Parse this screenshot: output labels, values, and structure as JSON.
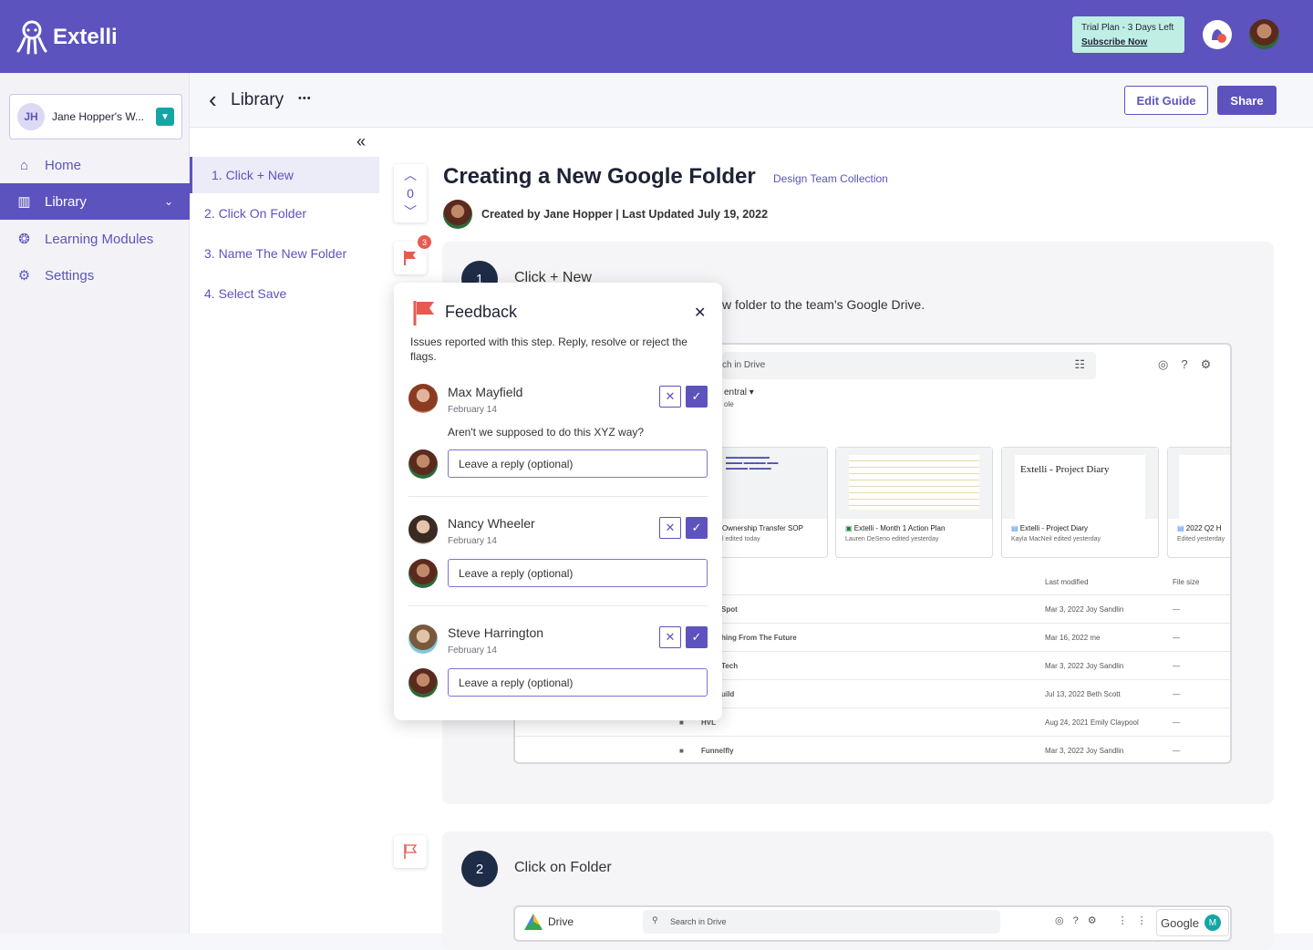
{
  "app": {
    "name": "Extelli",
    "trial_line1": "Trial Plan - 3 Days Left",
    "trial_line2": "Subscribe Now"
  },
  "workspace": {
    "initials": "JH",
    "name": "Jane Hopper's W..."
  },
  "sidebar": {
    "items": [
      {
        "label": "Home",
        "icon": "home-icon"
      },
      {
        "label": "Library",
        "icon": "library-icon"
      },
      {
        "label": "Learning Modules",
        "icon": "modules-icon"
      },
      {
        "label": "Settings",
        "icon": "gear-icon"
      }
    ]
  },
  "header": {
    "back": "‹",
    "title": "Library",
    "more": "•••",
    "edit_label": "Edit Guide",
    "share_label": "Share"
  },
  "steps": [
    "1. Click + New",
    "2. Click On Folder",
    "3. Name The New Folder",
    "4. Select Save"
  ],
  "guide": {
    "title": "Creating a New Google Folder",
    "collection": "Design Team Collection",
    "meta": "Created by Jane Hopper | Last Updated July 19, 2022",
    "vote_count": "0",
    "flag_count": "3"
  },
  "step1": {
    "num": "1",
    "title": "Click + New",
    "desc": "w folder to the team's Google Drive."
  },
  "step2": {
    "num": "2",
    "title": "Click on Folder"
  },
  "drive1": {
    "search": "ch in Drive",
    "folder": "entral",
    "sub": "ole",
    "cards": [
      {
        "title": "Ownership Transfer SOP",
        "sub": "l edited today"
      },
      {
        "title": "Extelli - Month 1 Action Plan",
        "sub": "Lauren DeSeno edited yesterday"
      },
      {
        "title": "Extelli - Project Diary",
        "sub": "Kayla MacNeil edited yesterday",
        "thumb": "Extelli - Project Diary"
      },
      {
        "title": "2022 Q2 H",
        "sub": "Edited yesterday"
      }
    ],
    "col_modified": "Last modified",
    "col_size": "File size",
    "rows": [
      {
        "name": "Spot",
        "date": "Mar 3, 2022",
        "owner": "Joy Sandlin",
        "size": "—"
      },
      {
        "name": "hing From The Future",
        "date": "Mar 16, 2022",
        "owner": "me",
        "size": "—"
      },
      {
        "name": "Tech",
        "date": "Mar 3, 2022",
        "owner": "Joy Sandlin",
        "size": "—"
      },
      {
        "name": "uild",
        "date": "Jul 13, 2022",
        "owner": "Beth Scott",
        "size": "—"
      },
      {
        "name": "HVL",
        "date": "Aug 24, 2021",
        "owner": "Emily Claypool",
        "size": "—"
      },
      {
        "name": "Funnelfly",
        "date": "Mar 3, 2022",
        "owner": "Joy Sandlin",
        "size": "—"
      }
    ]
  },
  "drive2": {
    "brand": "Drive",
    "search": "Search in Drive",
    "google": "Google",
    "avatar": "M"
  },
  "feedback": {
    "title": "Feedback",
    "close": "✕",
    "desc": "Issues reported with this step. Reply, resolve or reject the flags.",
    "entries": [
      {
        "name": "Max Mayfield",
        "date": "February 14",
        "comment": "Aren't we supposed to do this XYZ way?",
        "reply_placeholder": "Leave a reply (optional)"
      },
      {
        "name": "Nancy Wheeler",
        "date": "February 14",
        "comment": "",
        "reply_placeholder": "Leave a reply (optional)"
      },
      {
        "name": "Steve Harrington",
        "date": "February 14",
        "comment": "",
        "reply_placeholder": "Leave a reply (optional)"
      }
    ]
  },
  "colors": {
    "brand": "#5c53bf",
    "accent": "#16a5a5",
    "flag": "#e85a4f",
    "dark": "#1e2c48"
  }
}
